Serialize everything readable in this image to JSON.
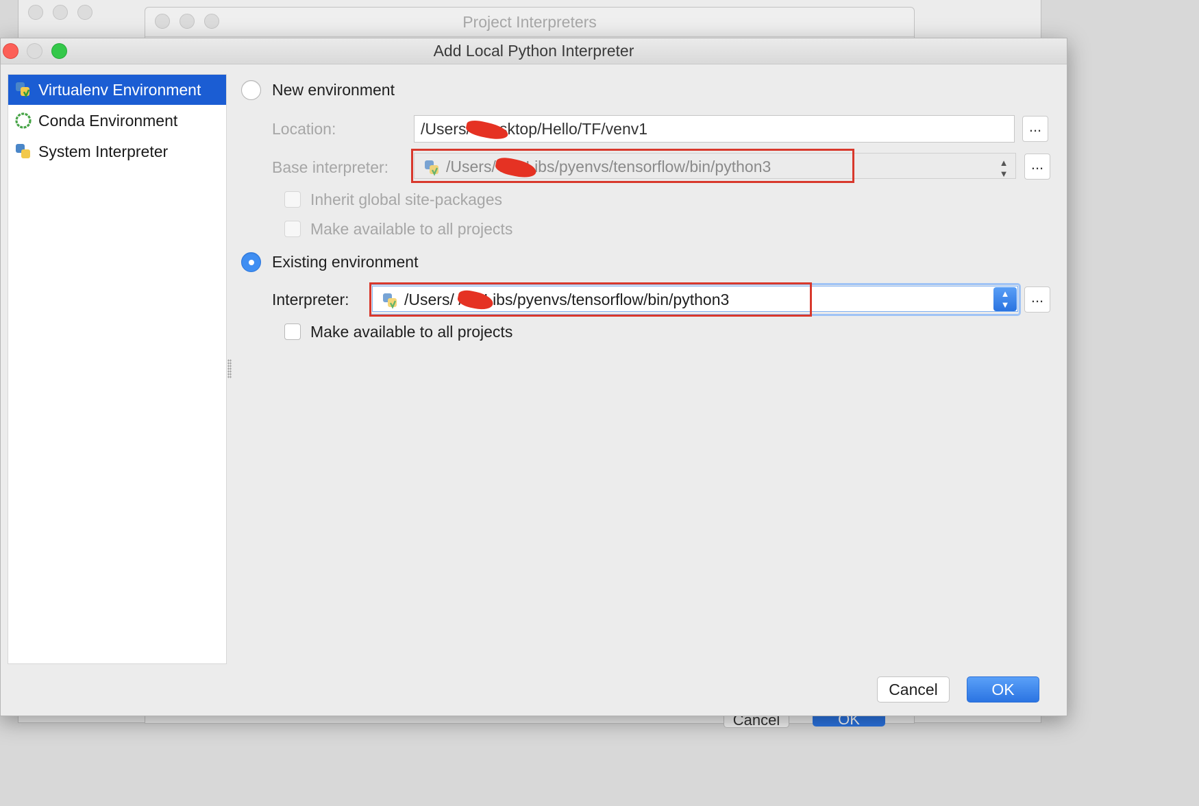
{
  "background": {
    "window_title": "Project Interpreters",
    "bottom_buttons": [
      "Cancel",
      "OK"
    ]
  },
  "dialog": {
    "title": "Add Local Python Interpreter"
  },
  "sidebar": {
    "items": [
      {
        "label": "Virtualenv Environment",
        "icon": "virtualenv-icon",
        "selected": true
      },
      {
        "label": "Conda Environment",
        "icon": "conda-icon",
        "selected": false
      },
      {
        "label": "System Interpreter",
        "icon": "python-icon",
        "selected": false
      }
    ]
  },
  "new_env": {
    "radio_label": "New environment",
    "selected": false,
    "location_label": "Location:",
    "location_value": "/Users/      /Desktop/Hello/TF/venv1",
    "base_label": "Base interpreter:",
    "base_value": "/Users/      /myLibs/pyenvs/tensorflow/bin/python3",
    "inherit_label": "Inherit global site-packages",
    "inherit_checked": false,
    "available_label": "Make available to all projects",
    "available_checked": false,
    "browse_label": "..."
  },
  "existing_env": {
    "radio_label": "Existing environment",
    "selected": true,
    "interpreter_label": "Interpreter:",
    "interpreter_value": "/Users/      /myLibs/pyenvs/tensorflow/bin/python3",
    "available_label": "Make available to all projects",
    "available_checked": false,
    "browse_label": "..."
  },
  "buttons": {
    "cancel": "Cancel",
    "ok": "OK"
  },
  "colors": {
    "selection": "#1b5dd3",
    "accent": "#3f8ef2",
    "annotation": "#d8382c"
  }
}
